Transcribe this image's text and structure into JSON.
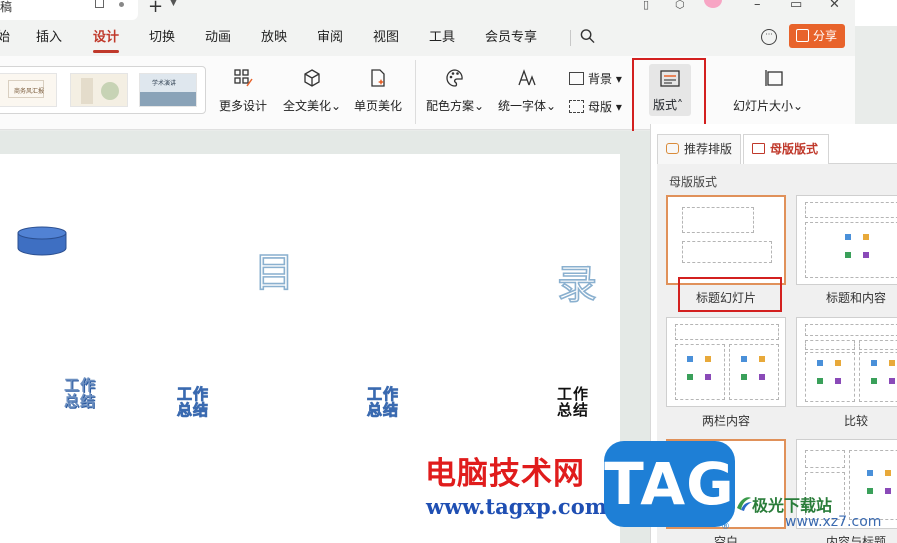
{
  "titlebar": {
    "doc_tab": "稿"
  },
  "menu": {
    "items": [
      "始",
      "插入",
      "设计",
      "切换",
      "动画",
      "放映",
      "审阅",
      "视图",
      "工具",
      "会员专享"
    ],
    "active": "设计",
    "share": "分享"
  },
  "ribbon": {
    "more_design": "更多设计",
    "beautify_all": "全文美化",
    "beautify_page": "单页美化",
    "color_scheme": "配色方案",
    "unify_font": "统一字体",
    "background": "背景",
    "master": "母版",
    "layout": "版式",
    "slide_size": "幻灯片大小",
    "thumb_texts": [
      "商务风汇报",
      "",
      "学术演讲"
    ]
  },
  "slide": {
    "big_left": "目",
    "big_right": "录",
    "items": [
      "工作\n总结",
      "工作\n总结",
      "工作\n总结",
      "工作\n总结"
    ]
  },
  "panel": {
    "tab_recommended": "推荐排版",
    "tab_master": "母版版式",
    "section": "母版版式",
    "layouts": [
      {
        "label": "标题幻灯片"
      },
      {
        "label": "标题和内容"
      },
      {
        "label": "两栏内容"
      },
      {
        "label": "比较"
      },
      {
        "label": "空白"
      },
      {
        "label": "内容与标题"
      }
    ]
  },
  "watermark": {
    "cn": "电脑技术网",
    "url": "www.tagxp.com",
    "logo": "TAG",
    "site_cn": "极光下载站",
    "site_url": "www.xz7.com"
  },
  "colors": {
    "accent": "#c0392b",
    "share": "#e8632b",
    "highlight_box": "#d3201f",
    "tag_blue": "#1e7fd6"
  }
}
